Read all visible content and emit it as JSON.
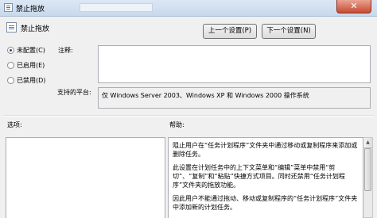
{
  "window": {
    "title": "禁止拖放",
    "close_symbol": "✕"
  },
  "header": {
    "title": "禁止拖放"
  },
  "nav": {
    "prev_label": "上一个设置(P)",
    "next_label": "下一个设置(N)"
  },
  "state": {
    "options": [
      {
        "label": "未配置(C)",
        "selected": true
      },
      {
        "label": "已启用(E)",
        "selected": false
      },
      {
        "label": "已禁用(D)",
        "selected": false
      }
    ]
  },
  "comment": {
    "label": "注释:",
    "value": ""
  },
  "platform": {
    "label": "支持的平台:",
    "value": "仅 Windows Server 2003、Windows XP 和 Windows 2000 操作系统"
  },
  "options_panel": {
    "label": "选项:"
  },
  "help_panel": {
    "label": "帮助:",
    "paragraphs": [
      "阻止用户在“任务计划程序”文件夹中通过移动或复制程序来添加或删除任务。",
      "此设置在计划任务中的上下文菜单和“编辑”菜单中禁用“剪切”、“复制”和“粘贴”快捷方式项目。同时还禁用“任务计划程序”文件夹的拖放功能。",
      "因此用户不能通过拖动、移动或复制程序的“任务计划程序”文件夹中添加新的计划任务。"
    ]
  }
}
